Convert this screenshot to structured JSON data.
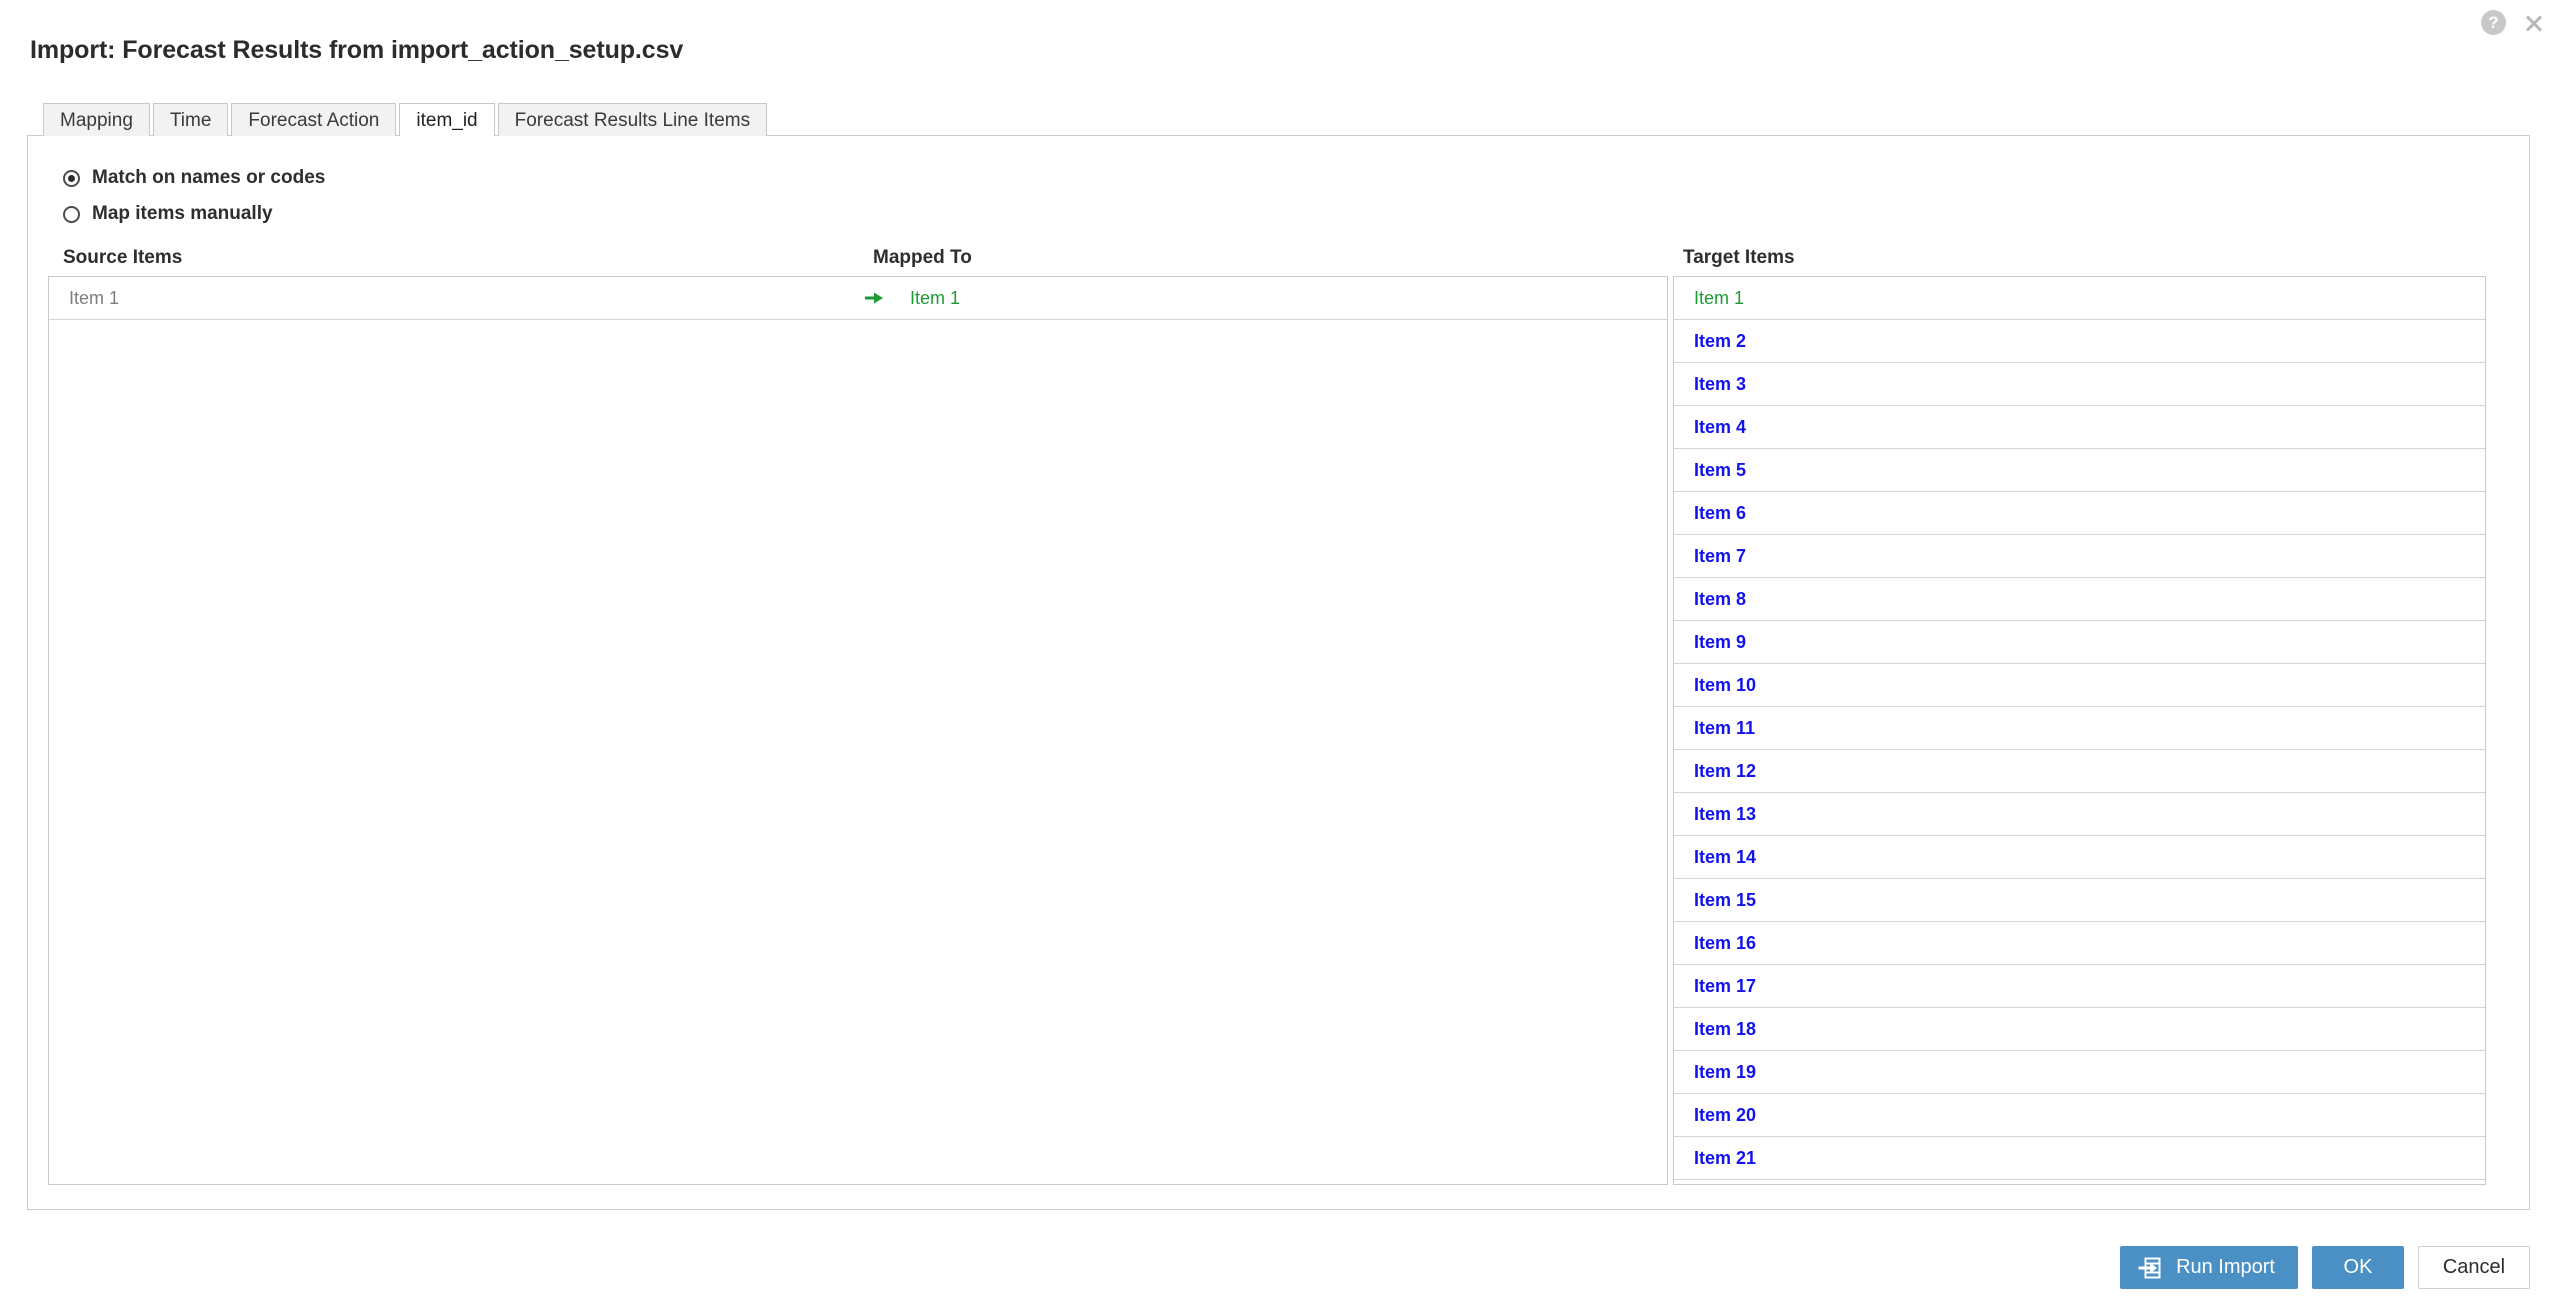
{
  "window": {
    "help_icon": "help-circle-icon",
    "help_glyph": "?",
    "close_icon": "close-icon"
  },
  "dialog": {
    "title": "Import: Forecast Results from import_action_setup.csv"
  },
  "tabs": [
    {
      "label": "Mapping",
      "active": false
    },
    {
      "label": "Time",
      "active": false
    },
    {
      "label": "Forecast Action",
      "active": false
    },
    {
      "label": "item_id",
      "active": true
    },
    {
      "label": "Forecast Results Line Items",
      "active": false
    }
  ],
  "options": {
    "match_on_names_or_codes": {
      "label": "Match on names or codes",
      "selected": true
    },
    "map_items_manually": {
      "label": "Map items manually",
      "selected": false
    }
  },
  "headers": {
    "source": "Source Items",
    "mapped": "Mapped To",
    "target": "Target Items"
  },
  "mappings": [
    {
      "source": "Item 1",
      "arrow": "arrow-right-icon",
      "target": "Item 1"
    }
  ],
  "target_items": [
    {
      "label": "Item 1",
      "mapped": true
    },
    {
      "label": "Item 2",
      "mapped": false
    },
    {
      "label": "Item 3",
      "mapped": false
    },
    {
      "label": "Item 4",
      "mapped": false
    },
    {
      "label": "Item 5",
      "mapped": false
    },
    {
      "label": "Item 6",
      "mapped": false
    },
    {
      "label": "Item 7",
      "mapped": false
    },
    {
      "label": "Item 8",
      "mapped": false
    },
    {
      "label": "Item 9",
      "mapped": false
    },
    {
      "label": "Item 10",
      "mapped": false
    },
    {
      "label": "Item 11",
      "mapped": false
    },
    {
      "label": "Item 12",
      "mapped": false
    },
    {
      "label": "Item 13",
      "mapped": false
    },
    {
      "label": "Item 14",
      "mapped": false
    },
    {
      "label": "Item 15",
      "mapped": false
    },
    {
      "label": "Item 16",
      "mapped": false
    },
    {
      "label": "Item 17",
      "mapped": false
    },
    {
      "label": "Item 18",
      "mapped": false
    },
    {
      "label": "Item 19",
      "mapped": false
    },
    {
      "label": "Item 20",
      "mapped": false
    },
    {
      "label": "Item 21",
      "mapped": false
    }
  ],
  "footer": {
    "run_import_label": "Run Import",
    "run_import_icon": "import-into-box-icon",
    "ok_label": "OK",
    "cancel_label": "Cancel"
  },
  "colors": {
    "primary_button": "#4a90c4",
    "mapped_green": "#1d9b33",
    "target_blue": "#1212ef",
    "panel_border": "#c9c9c9"
  }
}
